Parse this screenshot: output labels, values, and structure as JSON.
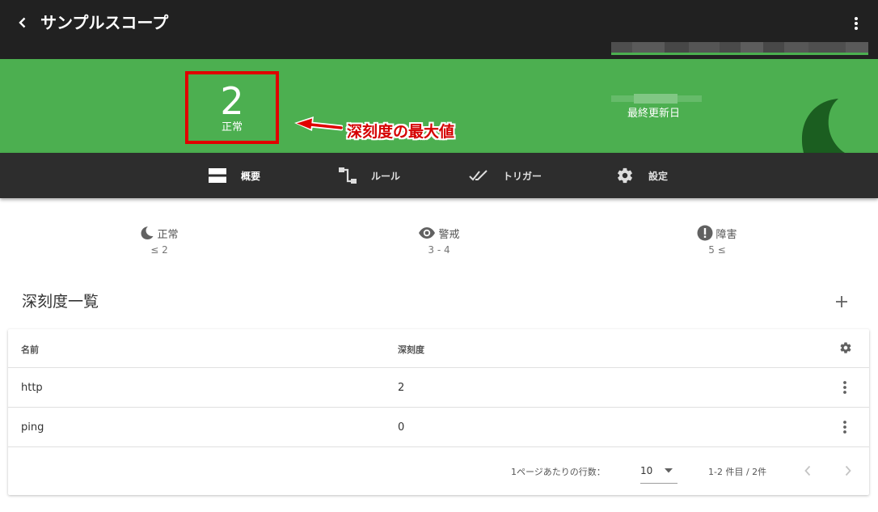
{
  "appbar": {
    "title": "サンプルスコープ"
  },
  "banner": {
    "severity_value": "2",
    "severity_status": "正常",
    "annotation": "深刻度の最大値",
    "updated_label": "最終更新日"
  },
  "nav": {
    "items": [
      {
        "label": "概要",
        "icon": "view-agenda-icon"
      },
      {
        "label": "ルール",
        "icon": "flow-icon"
      },
      {
        "label": "トリガー",
        "icon": "double-check-icon"
      },
      {
        "label": "設定",
        "icon": "gear-icon"
      }
    ]
  },
  "legend": [
    {
      "label": "正常",
      "range": "≤ 2",
      "icon": "moon-icon"
    },
    {
      "label": "警戒",
      "range": "3 - 4",
      "icon": "eye-icon"
    },
    {
      "label": "障害",
      "range": "5 ≤",
      "icon": "alert-circle-icon"
    }
  ],
  "section": {
    "title": "深刻度一覧"
  },
  "table": {
    "headers": [
      "名前",
      "深刻度"
    ],
    "rows": [
      {
        "name": "http",
        "severity": "2"
      },
      {
        "name": "ping",
        "severity": "0"
      }
    ]
  },
  "pagination": {
    "rows_per_page_label": "1ページあたりの行数：",
    "rows_per_page": "10",
    "range_info": "1-2 件目 / 2件"
  },
  "colors": {
    "appbar": "#212121",
    "banner": "#4caf50",
    "nav": "#2d2d2d",
    "annotation": "#e00000"
  }
}
